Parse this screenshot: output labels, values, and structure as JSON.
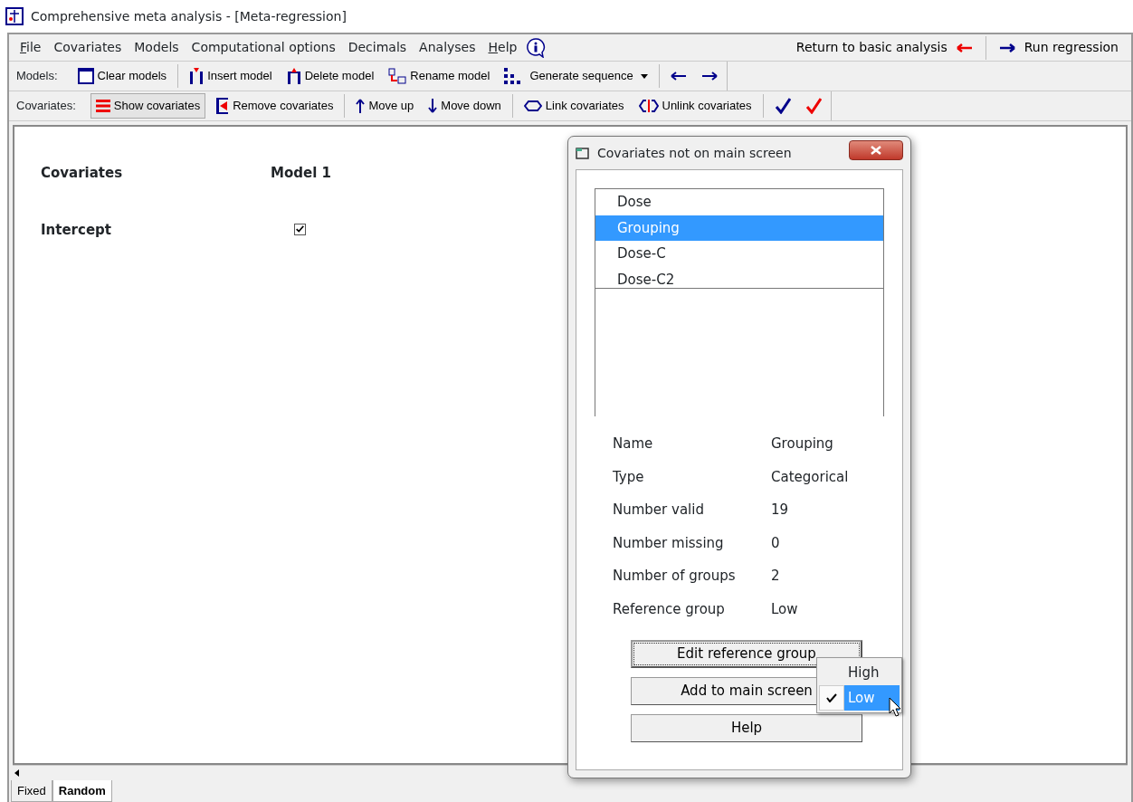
{
  "window": {
    "title": "Comprehensive meta analysis - [Meta-regression]"
  },
  "menu": [
    {
      "label": "File",
      "underline_first": true
    },
    {
      "label": "Covariates",
      "underline_first": false
    },
    {
      "label": "Models",
      "underline_first": false
    },
    {
      "label": "Computational options",
      "underline_first": false
    },
    {
      "label": "Decimals",
      "underline_first": false
    },
    {
      "label": "Analyses",
      "underline_first": false
    },
    {
      "label": "Help",
      "underline_first": true
    }
  ],
  "menu_right": [
    {
      "label": "Return to basic analysis"
    },
    {
      "label": "Run regression"
    }
  ],
  "models_toolbar": {
    "label": "Models:",
    "buttons": [
      {
        "label": "Clear models",
        "pressed": false
      },
      {
        "label": "Insert model",
        "pressed": false
      },
      {
        "label": "Delete model",
        "pressed": false
      },
      {
        "label": "Rename model",
        "pressed": false
      },
      {
        "label": "Generate sequence",
        "pressed": false
      }
    ]
  },
  "covariates_toolbar": {
    "label": "Covariates:",
    "buttons": [
      {
        "label": "Show covariates",
        "pressed": true
      },
      {
        "label": "Remove covariates",
        "pressed": false
      },
      {
        "label": "Move up",
        "pressed": false
      },
      {
        "label": "Move down",
        "pressed": false
      },
      {
        "label": "Link covariates",
        "pressed": false
      },
      {
        "label": "Unlink covariates",
        "pressed": false
      }
    ]
  },
  "grid": {
    "columns": [
      "Covariates",
      "Model 1"
    ],
    "rows": [
      {
        "name": "Intercept",
        "checked": true
      }
    ]
  },
  "sheet_tabs": [
    {
      "label": "Fixed",
      "selected": false
    },
    {
      "label": "Random",
      "selected": true
    }
  ],
  "dialog": {
    "title": "Covariates not on main screen",
    "covariates": [
      {
        "label": "Dose",
        "selected": false
      },
      {
        "label": "Grouping",
        "selected": true
      },
      {
        "label": "Dose-C",
        "selected": false
      },
      {
        "label": "Dose-C2",
        "selected": false
      }
    ],
    "properties": [
      {
        "name": "Name",
        "value": "Grouping"
      },
      {
        "name": "Type",
        "value": "Categorical"
      },
      {
        "name": "Number valid",
        "value": "19"
      },
      {
        "name": "Number missing",
        "value": "0"
      },
      {
        "name": "Number of groups",
        "value": "2"
      },
      {
        "name": "Reference group",
        "value": "Low"
      }
    ],
    "buttons": [
      {
        "label": "Edit reference group",
        "focused": true
      },
      {
        "label": "Add to main screen",
        "focused": false
      },
      {
        "label": "Help",
        "focused": false
      }
    ],
    "popup": [
      {
        "label": "High",
        "checked": false,
        "selected": false
      },
      {
        "label": "Low",
        "checked": true,
        "selected": true
      }
    ]
  }
}
